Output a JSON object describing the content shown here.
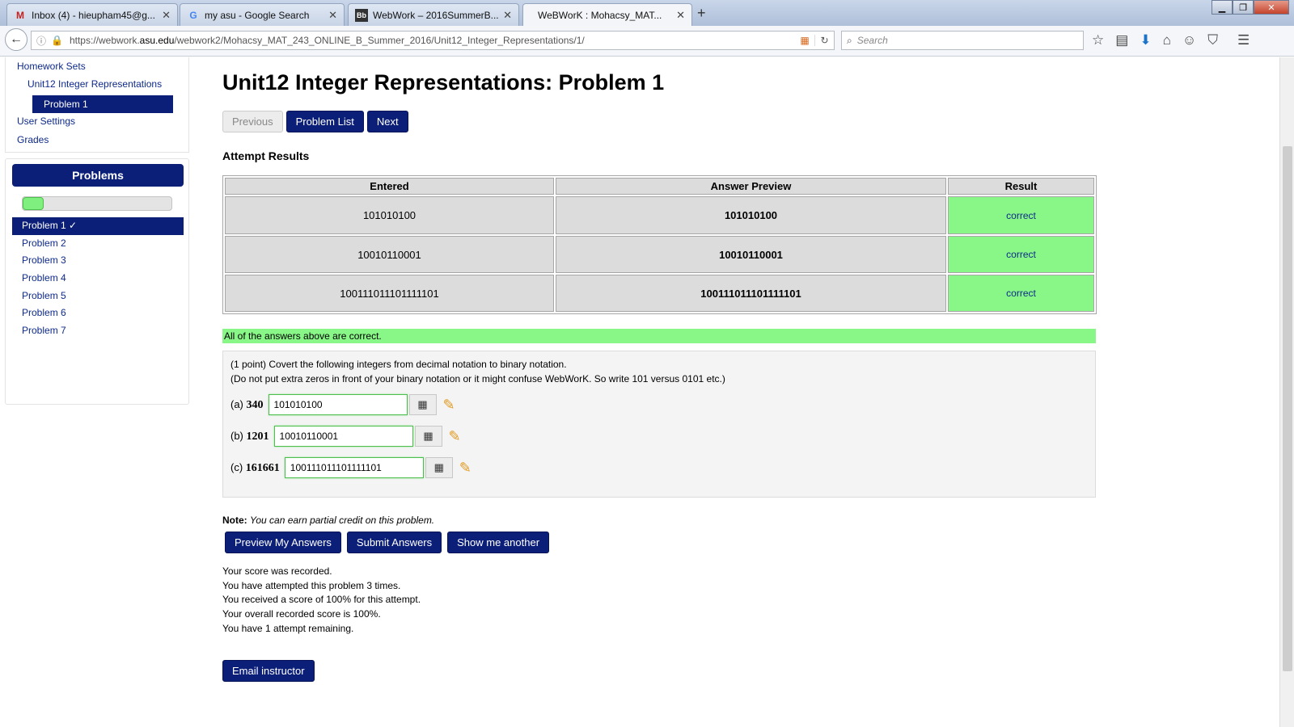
{
  "browser": {
    "tabs": [
      {
        "title": "Inbox (4) - hieupham45@g...",
        "icon": "gmail-icon",
        "active": false
      },
      {
        "title": "my asu - Google Search",
        "icon": "google-icon",
        "active": false
      },
      {
        "title": "WebWork – 2016SummerB...",
        "icon": "blackboard-icon",
        "active": false
      },
      {
        "title": "WeBWorK : Mohacsy_MAT...",
        "icon": "",
        "active": true
      }
    ],
    "url_prefix": "https://webwork.",
    "url_domain": "asu.edu",
    "url_path": "/webwork2/Mohacsy_MAT_243_ONLINE_B_Summer_2016/Unit12_Integer_Representations/1/",
    "search_placeholder": "Search"
  },
  "sidebar": {
    "homework_sets": "Homework Sets",
    "set_name": "Unit12 Integer Representations",
    "current_problem": "Problem 1",
    "user_settings": "User Settings",
    "grades": "Grades"
  },
  "problems_panel": {
    "title": "Problems",
    "progress_fraction": 0.143,
    "items": [
      "Problem 1 ✓",
      "Problem 2",
      "Problem 3",
      "Problem 4",
      "Problem 5",
      "Problem 6",
      "Problem 7"
    ]
  },
  "main": {
    "title": "Unit12 Integer Representations: Problem 1",
    "nav": {
      "previous": "Previous",
      "problem_list": "Problem List",
      "next": "Next"
    },
    "attempt_title": "Attempt Results",
    "results": {
      "headers": [
        "Entered",
        "Answer Preview",
        "Result"
      ],
      "rows": [
        {
          "entered": "101010100",
          "preview": "101010100",
          "result": "correct"
        },
        {
          "entered": "10010110001",
          "preview": "10010110001",
          "result": "correct"
        },
        {
          "entered": "100111011101111101",
          "preview": "100111011101111101",
          "result": "correct"
        }
      ]
    },
    "all_correct": "All of the answers above are correct.",
    "problem": {
      "line1": "(1 point) Covert the following integers from decimal notation to binary notation.",
      "line2": "(Do not put extra zeros in front of your binary notation or it might confuse WebWorK. So write 101 versus 0101 etc.)",
      "answers": [
        {
          "label": "(a)",
          "number": "340",
          "value": "101010100"
        },
        {
          "label": "(b)",
          "number": "1201",
          "value": "10010110001"
        },
        {
          "label": "(c)",
          "number": "161661",
          "value": "100111011101111101"
        }
      ]
    },
    "note_label": "Note:",
    "note_text": "You can earn partial credit on this problem.",
    "buttons": {
      "preview": "Preview My Answers",
      "submit": "Submit Answers",
      "another": "Show me another"
    },
    "score_lines": [
      "Your score was recorded.",
      "You have attempted this problem 3 times.",
      "You received a score of 100% for this attempt.",
      "Your overall recorded score is 100%.",
      "You have 1 attempt remaining."
    ],
    "email": "Email instructor"
  },
  "colors": {
    "navy": "#0b1f78",
    "correct_green": "#88f787",
    "link": "#0e2a8a"
  }
}
